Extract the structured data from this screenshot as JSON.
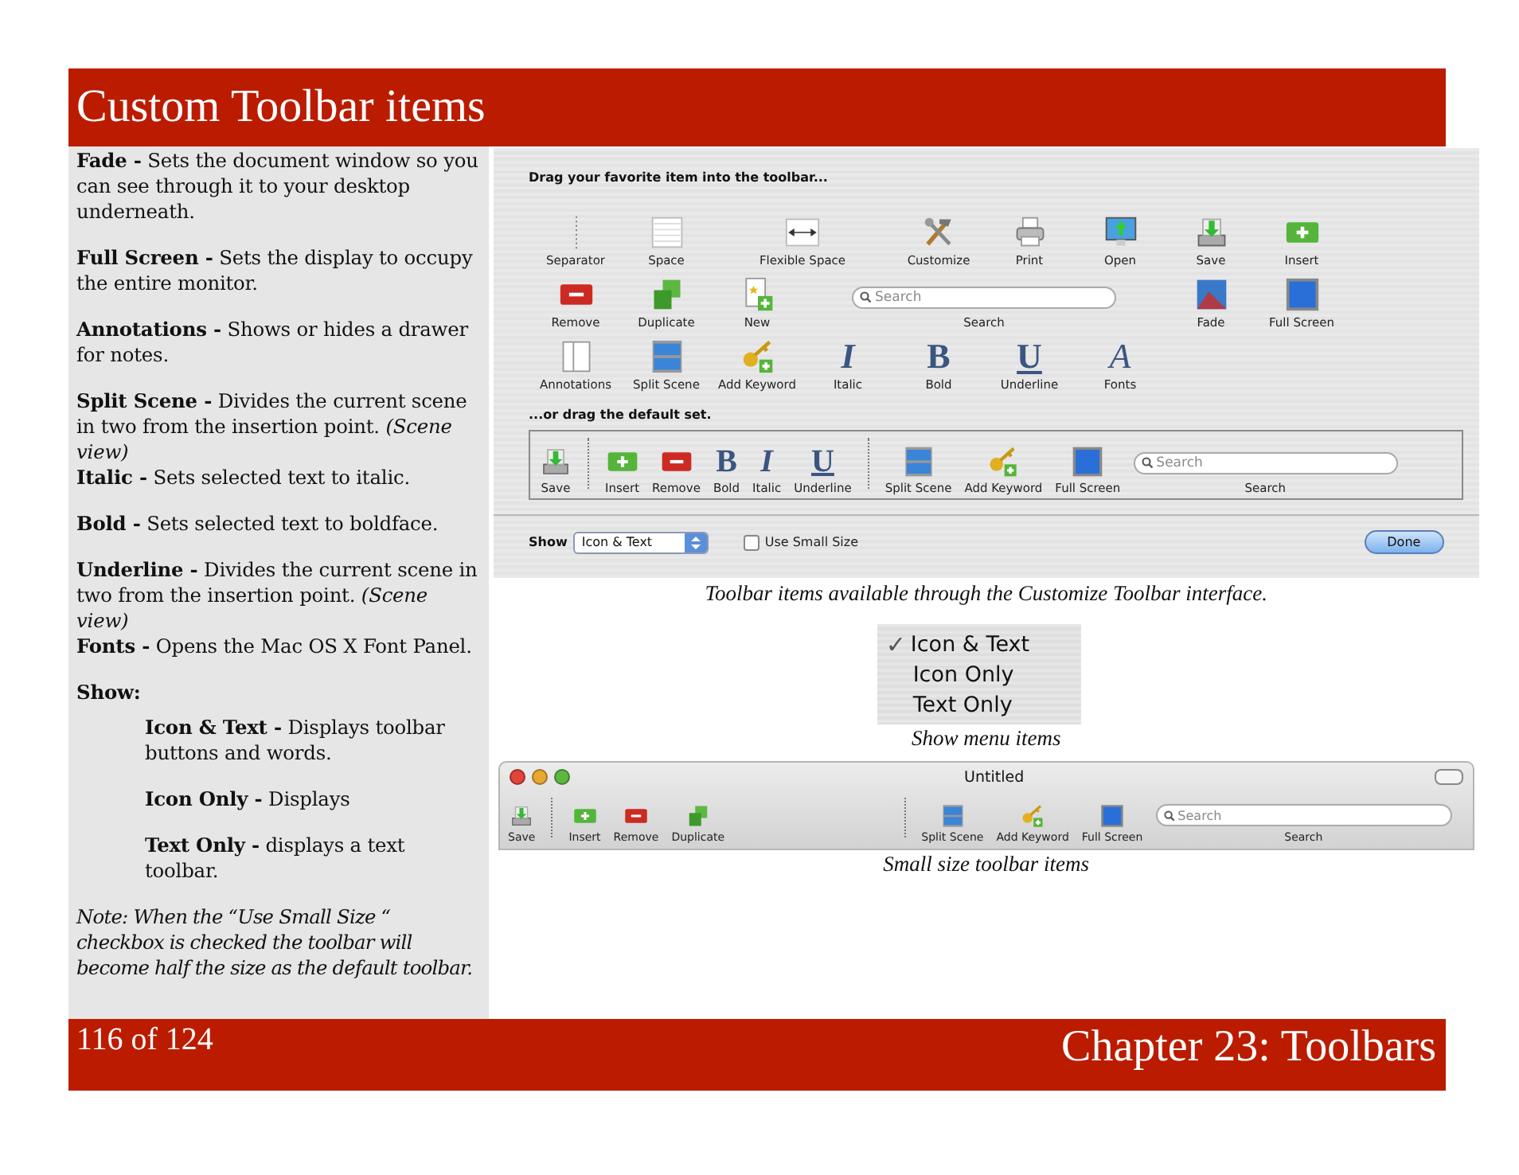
{
  "header": {
    "title": "Custom Toolbar items"
  },
  "sidebar": {
    "blocks": [
      [
        {
          "kind": "plain",
          "text": "**Fade -** Sets the document window so you can see through it to your desktop underneath."
        }
      ],
      [
        {
          "kind": "plain",
          "text": "**Full Screen -** Sets the display to occupy the entire monitor."
        }
      ],
      [
        {
          "kind": "plain",
          "text": "**Annotations -** Shows or hides a drawer for notes."
        }
      ],
      [
        {
          "kind": "plain",
          "text": "**Split Scene -** Divides the current scene in two from the insertion point. *(Scene view)*"
        },
        {
          "kind": "plain",
          "text": "**Italic -** Sets selected text to italic."
        }
      ],
      [
        {
          "kind": "plain",
          "text": "**Bold -** Sets selected text to boldface."
        }
      ],
      [
        {
          "kind": "plain",
          "text": "**Underline -** Divides the current scene in two from the insertion point. *(Scene view)*"
        },
        {
          "kind": "plain",
          "text": "**Fonts -** Opens the Mac OS X Font Panel."
        }
      ],
      [
        {
          "kind": "heading",
          "text": "Show:"
        },
        {
          "kind": "indented",
          "text": "**Icon & Text -** Displays toolbar buttons and words."
        }
      ],
      [
        {
          "kind": "indented",
          "text": "**Icon  Only -** Displays"
        }
      ],
      [
        {
          "kind": "indented",
          "text": "**Text Only -** displays a text toolbar."
        }
      ],
      [
        {
          "kind": "note",
          "text": "Note:  When the “Use Small Size “ checkbox is checked the toolbar will become half the size as the default toolbar."
        }
      ]
    ]
  },
  "customize_sheet": {
    "palette_heading": "Drag your favorite item into the toolbar...",
    "palette": [
      {
        "kind": "separator",
        "label": "Separator"
      },
      {
        "kind": "space",
        "label": "Space"
      },
      {
        "kind": "flexible-space",
        "label": "Flexible Space"
      },
      {
        "kind": "customize",
        "label": "Customize"
      },
      {
        "kind": "print",
        "label": "Print"
      },
      {
        "kind": "open",
        "label": "Open"
      },
      {
        "kind": "save",
        "label": "Save"
      },
      {
        "kind": "insert",
        "label": "Insert"
      },
      {
        "kind": "remove",
        "label": "Remove"
      },
      {
        "kind": "duplicate",
        "label": "Duplicate"
      },
      {
        "kind": "new",
        "label": "New"
      },
      {
        "kind": "search",
        "placeholder": "Search",
        "label": "Search"
      },
      {
        "kind": "fade",
        "label": "Fade"
      },
      {
        "kind": "full-screen",
        "label": "Full Screen"
      },
      {
        "kind": "annotations",
        "label": "Annotations"
      },
      {
        "kind": "split-scene",
        "label": "Split Scene"
      },
      {
        "kind": "add-keyword",
        "label": "Add Keyword"
      },
      {
        "kind": "italic",
        "glyph": "I",
        "label": "Italic"
      },
      {
        "kind": "bold",
        "glyph": "B",
        "label": "Bold"
      },
      {
        "kind": "underline",
        "glyph": "U",
        "label": "Underline"
      },
      {
        "kind": "fonts",
        "glyph": "A",
        "label": "Fonts"
      }
    ],
    "default_heading": "...or drag the default set.",
    "default_set": [
      {
        "kind": "save",
        "label": "Save"
      },
      {
        "kind": "separator"
      },
      {
        "kind": "insert",
        "label": "Insert"
      },
      {
        "kind": "remove",
        "label": "Remove"
      },
      {
        "kind": "bold",
        "glyph": "B",
        "label": "Bold"
      },
      {
        "kind": "italic",
        "glyph": "I",
        "label": "Italic"
      },
      {
        "kind": "underline",
        "glyph": "U",
        "label": "Underline"
      },
      {
        "kind": "separator"
      },
      {
        "kind": "split-scene",
        "label": "Split Scene"
      },
      {
        "kind": "add-keyword",
        "label": "Add Keyword"
      },
      {
        "kind": "full-screen",
        "label": "Full Screen"
      },
      {
        "kind": "search",
        "placeholder": "Search",
        "label": "Search"
      }
    ],
    "show_label": "Show",
    "show_popup": {
      "value": "Icon & Text"
    },
    "small_size": {
      "label": "Use Small Size",
      "checked": false
    },
    "done_button": "Done"
  },
  "caption_1": "Toolbar items available through the Customize Toolbar interface.",
  "show_menu": {
    "items": [
      {
        "label": "Icon & Text",
        "selected": true
      },
      {
        "label": "Icon Only",
        "selected": false
      },
      {
        "label": "Text Only",
        "selected": false
      }
    ],
    "check": "✓"
  },
  "caption_2": "Show menu items",
  "small_window": {
    "title": "Untitled",
    "toolbar": [
      {
        "kind": "save",
        "label": "Save"
      },
      {
        "kind": "separator"
      },
      {
        "kind": "insert",
        "label": "Insert"
      },
      {
        "kind": "remove",
        "label": "Remove"
      },
      {
        "kind": "duplicate",
        "label": "Duplicate"
      },
      {
        "kind": "flexible-space"
      },
      {
        "kind": "separator"
      },
      {
        "kind": "split-scene",
        "label": "Split Scene"
      },
      {
        "kind": "add-keyword",
        "label": "Add Keyword"
      },
      {
        "kind": "full-screen",
        "label": "Full Screen"
      },
      {
        "kind": "search",
        "placeholder": "Search",
        "label": "Search"
      }
    ]
  },
  "caption_3": "Small size toolbar items",
  "footer": {
    "page": "116 of 124",
    "chapter": "Chapter 23: Toolbars"
  }
}
